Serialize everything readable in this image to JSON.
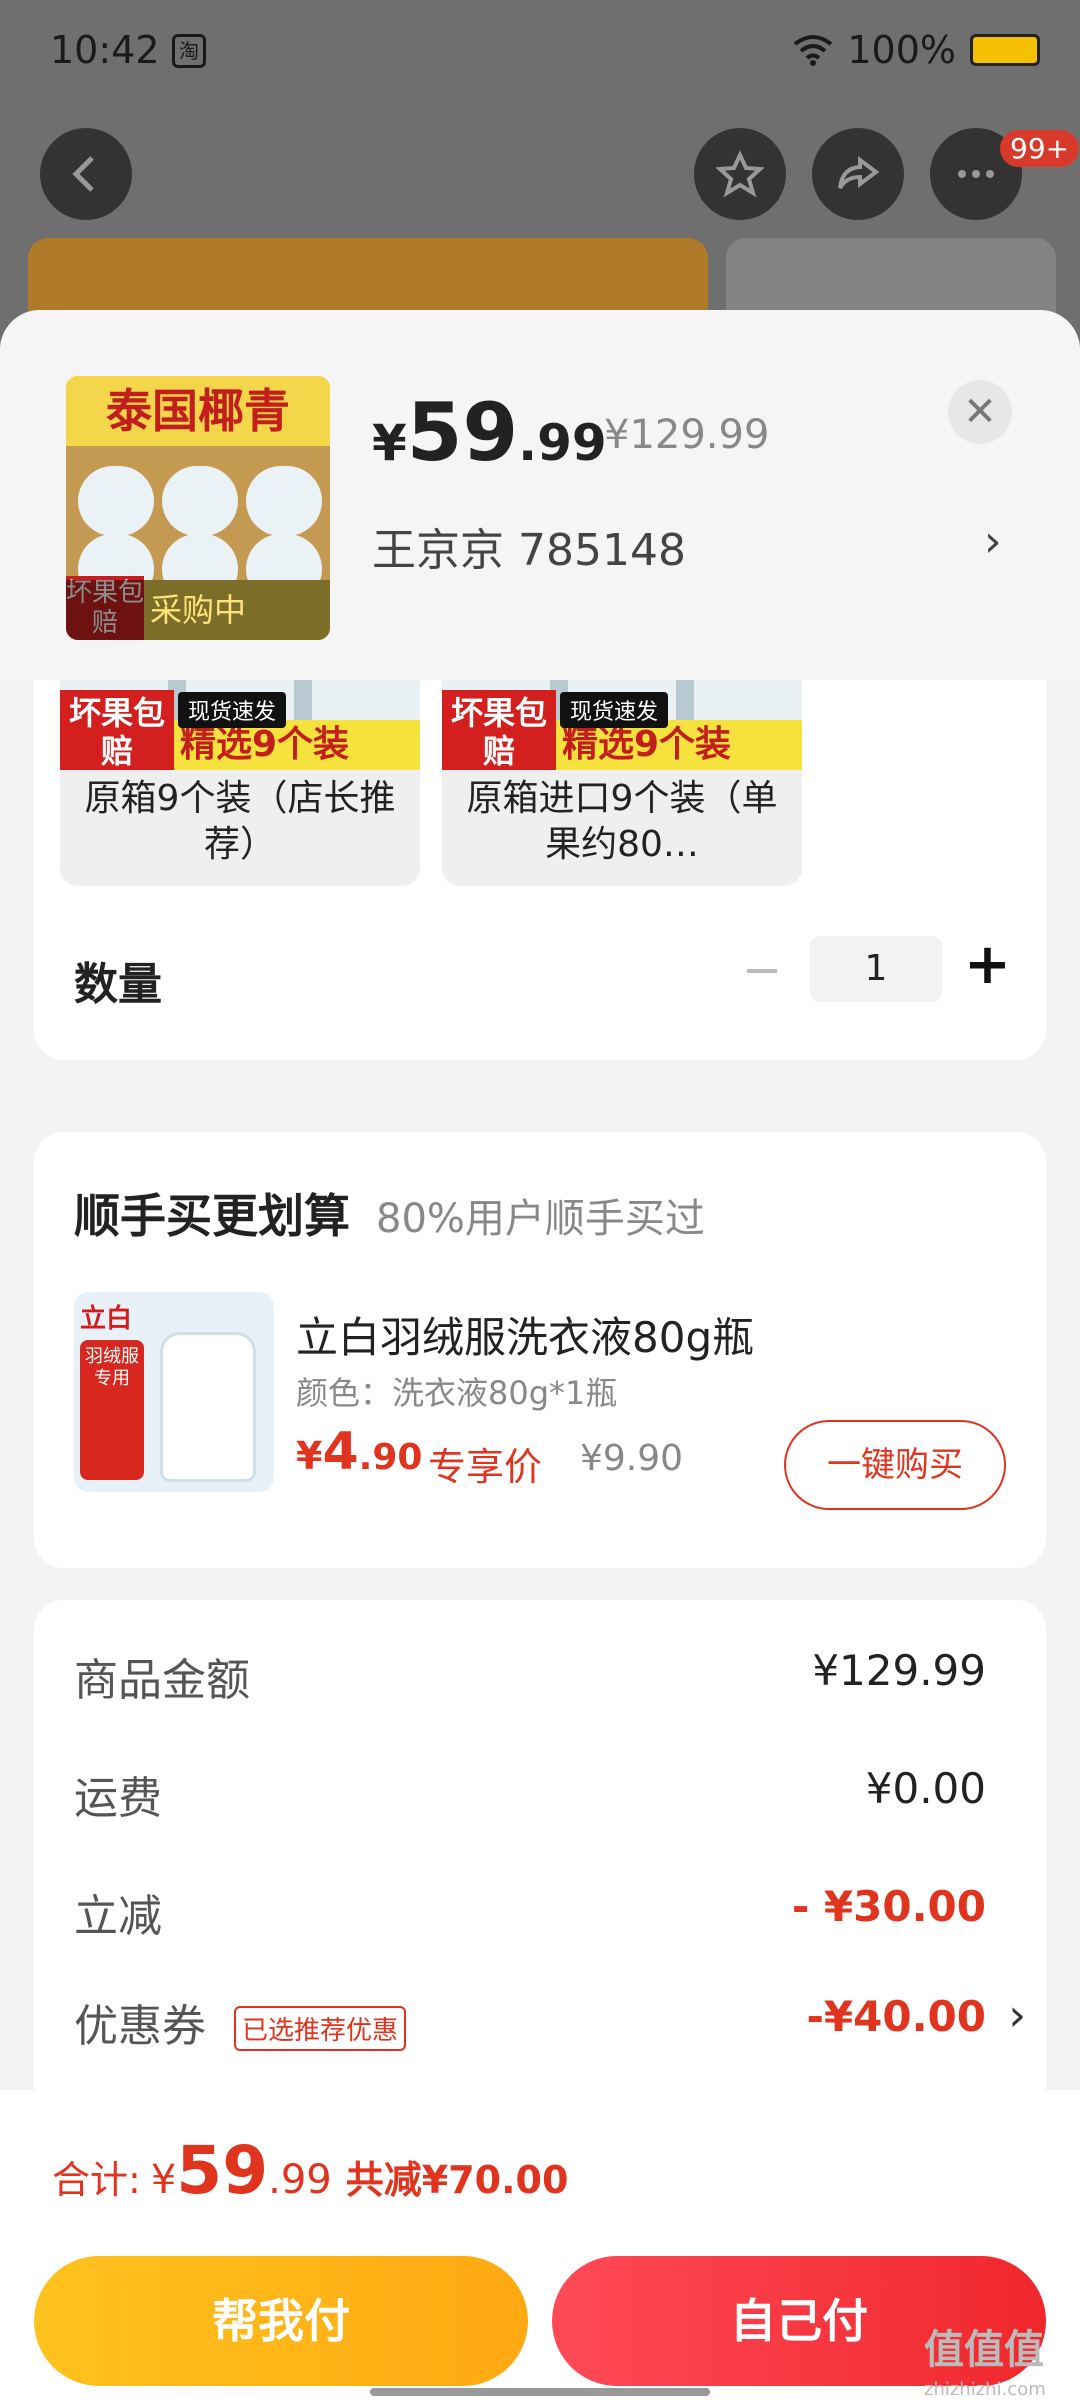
{
  "status_bar": {
    "time": "10:42",
    "app_badge": "淘",
    "battery": "100%"
  },
  "nav": {
    "cart_badge": "99+"
  },
  "header": {
    "product_image_title": "泰国椰青",
    "product_image_tag": "坏果包赔",
    "product_image_overlay": "采购中",
    "price_currency": "¥",
    "price_int": "59",
    "price_dec": ".99",
    "original_price": "¥129.99",
    "recipient": "王京京  785148"
  },
  "variants": [
    {
      "image_tag": "坏果包赔",
      "image_quick": "现货速发",
      "image_banner": "精选9个装",
      "label": "原箱9个装（店长推荐）"
    },
    {
      "image_tag": "坏果包赔",
      "image_quick": "现货速发",
      "image_banner": "精选9个装",
      "label": "原箱进口9个装（单果约80…"
    }
  ],
  "quantity": {
    "label": "数量",
    "value": "1"
  },
  "addon": {
    "title": "顺手买更划算",
    "subtitle": "80%用户顺手买过",
    "image_brand": "立白",
    "image_tag": "羽绒服专用",
    "name": "立白羽绒服洗衣液80g瓶",
    "spec": "颜色：洗衣液80g*1瓶",
    "price_currency": "¥",
    "price_int": "4",
    "price_dec": ".90",
    "exclusive": "专享价",
    "original_price": "¥9.90",
    "buy_button": "一键购买"
  },
  "summary": {
    "rows": [
      {
        "label": "商品金额",
        "value": "¥129.99"
      },
      {
        "label": "运费",
        "value": "¥0.00"
      },
      {
        "label": "立减",
        "value": "- ¥30.00"
      },
      {
        "label": "优惠券",
        "value": "-¥40.00",
        "tag": "已选推荐优惠"
      }
    ]
  },
  "footer": {
    "total_label": "合计:",
    "total_currency": "¥",
    "total_int": "59",
    "total_dec": ".99",
    "total_discount": "共减¥70.00",
    "help_pay": "帮我付",
    "self_pay": "自己付"
  },
  "watermark": {
    "main": "值值值",
    "sub": "zhizhizhi.com"
  },
  "colors": {
    "accent_red": "#e0341f",
    "help_yellow": "#ffb51a",
    "self_red": "#f0272c"
  }
}
